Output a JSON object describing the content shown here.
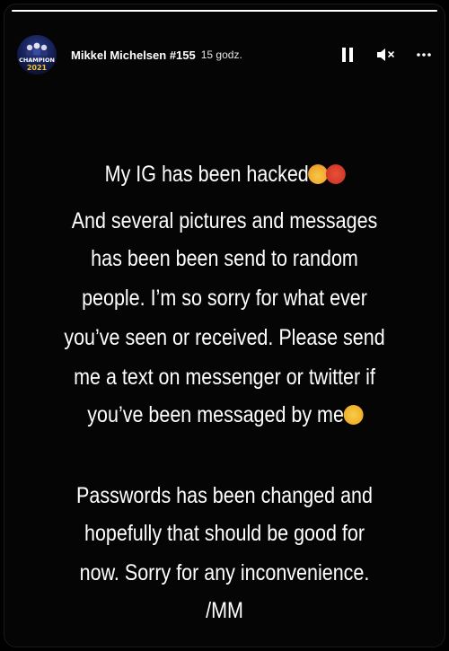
{
  "story": {
    "progress_fraction": 1.0,
    "avatar": {
      "line1": "CHAMPION",
      "line2": "2021"
    },
    "username": "Mikkel Michelsen #155",
    "time": "15 godz.",
    "controls": {
      "pause_icon": "pause-icon",
      "mute_icon": "volume-muted-icon",
      "more_icon": "more-horizontal-icon"
    },
    "message": {
      "lines": [
        "My IG has been hacked",
        "And several pictures and messages",
        "has been been send to random",
        "people. I’m so sorry for what ever",
        "you’ve seen or received. Please send",
        "me a text on messenger or twitter if",
        "you’ve been messaged by me",
        "",
        "Passwords has been changed and",
        "hopefully that should be good for",
        "now. Sorry for any inconvenience.",
        "/MM"
      ],
      "emojis": {
        "line1": [
          "exploding-head-emoji",
          "cursing-face-emoji"
        ],
        "line7": [
          "face-with-steam-emoji"
        ]
      }
    }
  }
}
